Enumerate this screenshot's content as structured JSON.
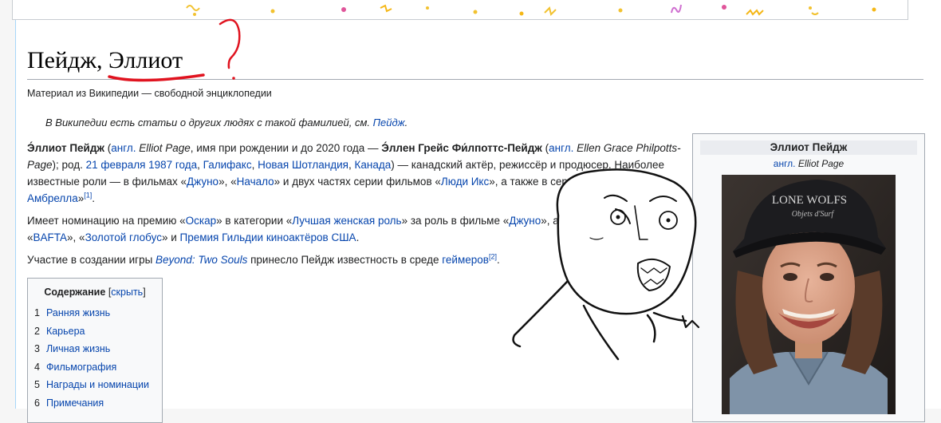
{
  "page": {
    "title": "Пейдж, Эллиот",
    "question_mark": "?",
    "tagline": "Материал из Википедии — свободной энциклопедии",
    "hatnote": {
      "prefix": "В Википедии есть статьи о других людях с такой фамилией, см. ",
      "link": "Пейдж",
      "suffix": "."
    }
  },
  "lead": {
    "p1": {
      "name_bold": "Э́ллиот Пейдж",
      "t1": " (",
      "lang1": "англ.",
      "en_name": " Elliot Page",
      "t2": ", имя при рождении и до 2020 года — ",
      "birth_name_bold": "Э́ллен Грейс Фи́лпоттс-Пейдж",
      "t3": " (",
      "lang2": "англ.",
      "en_birth_name": " Ellen Grace Philpotts-Page",
      "t4": "); род. ",
      "date_link": "21 февраля 1987 года",
      "comma1": ", ",
      "city_link": "Галифакс",
      "comma2": ", ",
      "province_link": "Новая Шотландия",
      "comma3": ", ",
      "country_link": "Канада",
      "t5": ") — канадский актёр, режиссёр и продюсер. Наиболее известные роли — в фильмах «",
      "film1": "Джуно",
      "t6": "», «",
      "film2": "Начало",
      "t7": "» и двух частях серии фильмов «",
      "film3": "Люди Икс",
      "t8": "», а также в сериале «",
      "series": "Академия Амбрелла",
      "t9": "»",
      "ref1": "[1]",
      "t10": "."
    },
    "p2": {
      "t1": "Имеет номинацию на премию «",
      "award1": "Оскар",
      "t2": "» в категории «",
      "category": "Лучшая женская роль",
      "t3": "» за роль в фильме «",
      "film": "Джуно",
      "t4": "», а также номинации — «",
      "award2": "BAFTA",
      "t5": "», «",
      "award3": "Золотой глобус",
      "t6": "» и ",
      "award4": "Премия Гильдии киноактёров США",
      "t7": "."
    },
    "p3": {
      "t1": "Участие в создании игры ",
      "game": "Beyond: Two Souls",
      "t2": " принесло Пейдж известность в среде ",
      "gamers": "геймеров",
      "ref2": "[2]",
      "t3": "."
    }
  },
  "toc": {
    "title": "Содержание",
    "toggle_open": "[",
    "toggle": "скрыть",
    "toggle_close": "]",
    "items": [
      {
        "num": "1",
        "label": "Ранняя жизнь"
      },
      {
        "num": "2",
        "label": "Карьера"
      },
      {
        "num": "3",
        "label": "Личная жизнь"
      },
      {
        "num": "4",
        "label": "Фильмография"
      },
      {
        "num": "5",
        "label": "Награды и номинации"
      },
      {
        "num": "6",
        "label": "Примечания"
      }
    ]
  },
  "infobox": {
    "title": "Эллиот Пейдж",
    "lang": "англ.",
    "subtitle": " Elliot Page",
    "cap_text_line1": "LONE WOLFS",
    "cap_text_line2": "Objets d'Surf"
  },
  "colors": {
    "link": "#0645ad",
    "underline_annotation": "#e0131f",
    "confetti": [
      "#f2c230",
      "#e0559a",
      "#cf6fd0",
      "#f5b716"
    ]
  },
  "icons": [
    "confetti-decoration",
    "rage-face-meme",
    "red-question-mark"
  ]
}
